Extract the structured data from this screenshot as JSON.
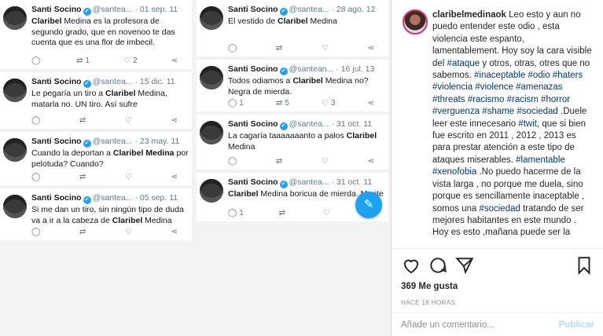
{
  "tweets": {
    "author": "Santi Socino",
    "verified_icon": "✔",
    "col1": [
      {
        "handle": "@santea...",
        "date": "· 01 sep. 11",
        "pre": "",
        "bold": "Claribel",
        "post": " Medina es la profesora de segundo grado, que en novenoo te das cuenta que es una flor de imbecil.",
        "replies": "",
        "retweets": "1",
        "likes": "2"
      },
      {
        "handle": "@santea...",
        "date": "· 15 dic. 11",
        "pre": "Le pegaría un tiro a ",
        "bold": "Claribel",
        "post": " Medina, matarla no. UN tiro. Así sufre",
        "replies": "",
        "retweets": "",
        "likes": ""
      },
      {
        "handle": "@santea...",
        "date": "· 23 may. 11",
        "pre": "Cuando la deportan a ",
        "bold": "Claribel Medina",
        "post": " por pelotuda? Cuando?",
        "replies": "",
        "retweets": "",
        "likes": ""
      },
      {
        "handle": "@santea...",
        "date": "· 05 sep. 11",
        "pre": "Si me dan un tiro, sin ningún tipo de duda va a ir a la cabeza de ",
        "bold": "Claribel",
        "post": " Medina",
        "replies": "",
        "retweets": "",
        "likes": ""
      }
    ],
    "col2": [
      {
        "handle": "@santea...",
        "date": "· 28 ago. 12",
        "pre": "El vestido de ",
        "bold": "Claribel",
        "post": " Medina",
        "replies": "",
        "retweets": "",
        "likes": ""
      },
      {
        "handle": "@santean...",
        "date": "· 16 jul. 13",
        "pre": "Todos odiamos a ",
        "bold": "Claribel",
        "post": " Medina no? Negra de mierda.",
        "replies": "1",
        "retweets": "5",
        "likes": "3"
      },
      {
        "handle": "@santea...",
        "date": "· 31 oct. 11",
        "pre": "La cagaría taaaaaaanto a palos ",
        "bold": "Claribel",
        "post": " Medina",
        "replies": "",
        "retweets": "",
        "likes": ""
      },
      {
        "handle": "@santea...",
        "date": "· 31 oct. 11",
        "pre": "",
        "bold": "Claribel",
        "post": " Medina boricua de mierda. Morite",
        "replies": "1",
        "retweets": "",
        "likes": ""
      }
    ]
  },
  "instagram": {
    "username": "claribelmedinaok",
    "caption_segments": [
      {
        "t": " Leo esto y aun no puedo entender este odio , esta violencia este espanto, lamentablement. Hoy soy la cara visible del ",
        "tag": false
      },
      {
        "t": "#ataque",
        "tag": true
      },
      {
        "t": " y otros, otras, otres que no sabemos. ",
        "tag": false
      },
      {
        "t": "#inaceptable #odio #haters #violencia #violence #amenazas #threats #racismo #racism #horror #verguenza #shame #sociedad",
        "tag": true
      },
      {
        "t": " .Duele leer este innecesario ",
        "tag": false
      },
      {
        "t": "#twit",
        "tag": true
      },
      {
        "t": ", que si bien fue escrito en 2011 , 2012 , 2013 es para prestar atención a este tipo de ataques miserables. ",
        "tag": false
      },
      {
        "t": "#lamentable #xenofobia",
        "tag": true
      },
      {
        "t": " .No puedo hacerme de la vista larga , no porque me duela, sino porque es sencillamente inaceptable , somos una ",
        "tag": false
      },
      {
        "t": "#sociedad",
        "tag": true
      },
      {
        "t": " tratando de ser mejores habitantes en este mundo . Hoy es esto ,mañana puede ser la",
        "tag": false
      }
    ],
    "likes": "369 Me gusta",
    "time": "HACE 18 HORAS",
    "comment_placeholder": "Añade un comentario...",
    "publish": "Publicar",
    "colors": {
      "tag": "#00376b",
      "twitter_blue": "#1da1f2",
      "publish": "#b2dffc"
    }
  }
}
